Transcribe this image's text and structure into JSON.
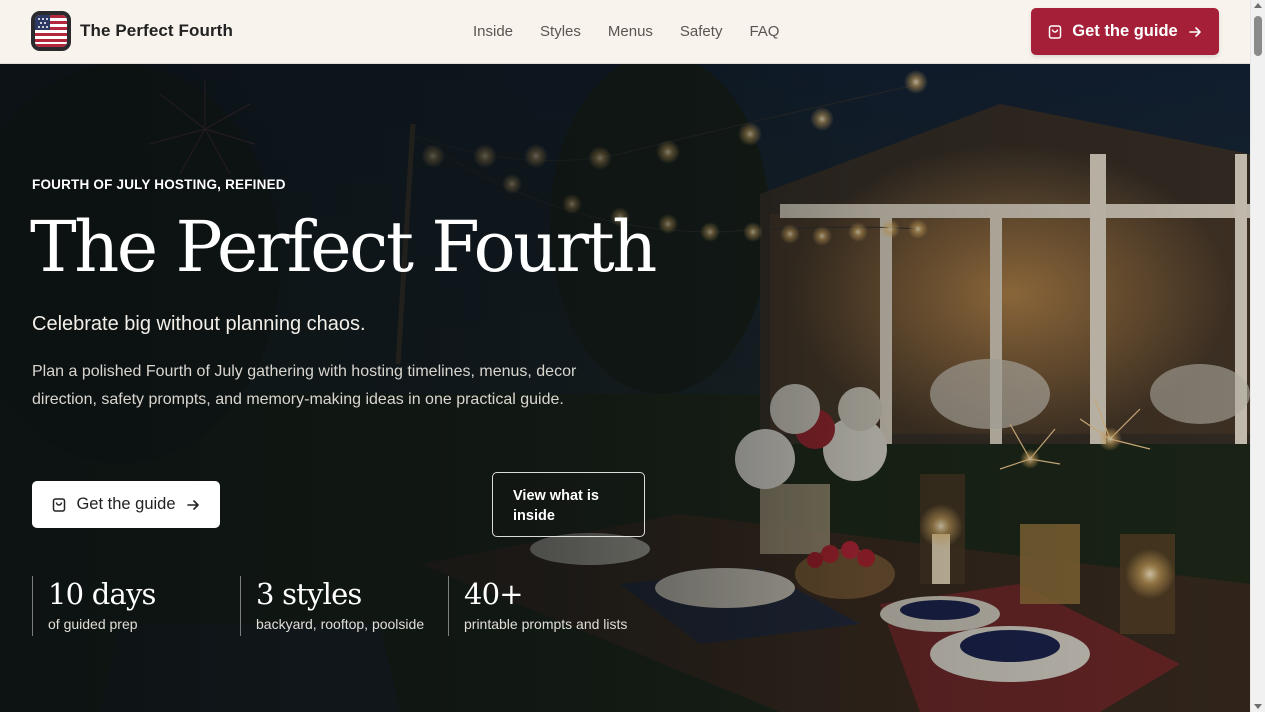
{
  "header": {
    "brand": "The Perfect Fourth",
    "nav": [
      "Inside",
      "Styles",
      "Menus",
      "Safety",
      "FAQ"
    ],
    "cta": "Get the guide"
  },
  "hero": {
    "eyebrow": "FOURTH OF JULY HOSTING, REFINED",
    "headline": "The Perfect Fourth",
    "subhead": "Celebrate big without planning chaos.",
    "description": "Plan a polished Fourth of July gathering with hosting timelines, menus, decor direction, safety prompts, and memory-making ideas in one practical guide.",
    "primary_button": "Get the guide",
    "secondary_button": "View what is inside",
    "stats": [
      {
        "value": "10 days",
        "label": "of guided prep"
      },
      {
        "value": "3 styles",
        "label": "backyard, rooftop, poolside"
      },
      {
        "value": "40+",
        "label": "printable prompts and lists"
      }
    ]
  },
  "colors": {
    "accent": "#a41f37",
    "header_bg": "#f8f3ec"
  },
  "icons": [
    "flag-logo-icon",
    "shopping-bag-icon",
    "arrow-right-icon"
  ]
}
